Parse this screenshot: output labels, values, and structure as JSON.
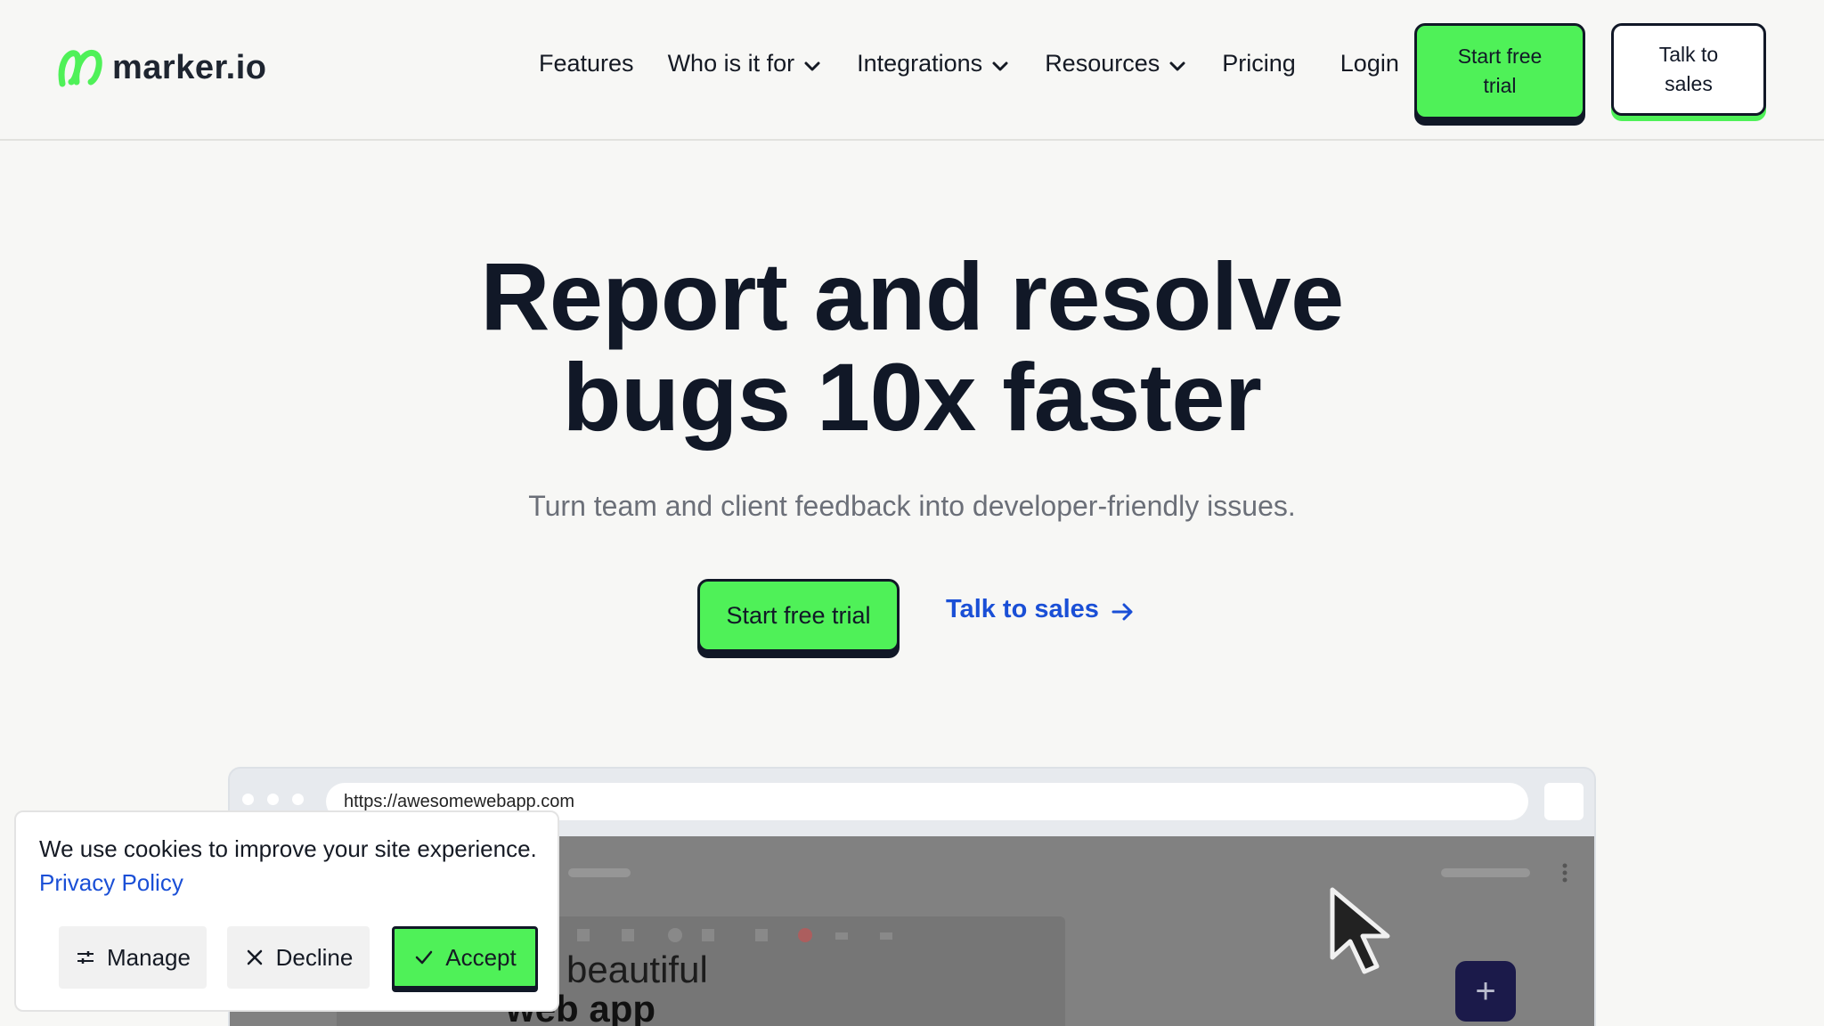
{
  "header": {
    "logo_text": "marker.io",
    "nav": [
      {
        "label": "Features",
        "has_dropdown": false
      },
      {
        "label": "Who is it for",
        "has_dropdown": true
      },
      {
        "label": "Integrations",
        "has_dropdown": true
      },
      {
        "label": "Resources",
        "has_dropdown": true
      },
      {
        "label": "Pricing",
        "has_dropdown": false
      },
      {
        "label": "Login",
        "has_dropdown": false
      }
    ],
    "trial_button": "Start free trial",
    "sales_button": "Talk to sales"
  },
  "hero": {
    "title_line1": "Report and resolve",
    "title_line2": "bugs 10x faster",
    "subtitle": "Turn team and client feedback into developer-friendly issues.",
    "cta_trial": "Start free trial",
    "cta_sales": "Talk to sales"
  },
  "browser_mock": {
    "url": "https://awesomewebapp.com",
    "headline_line1": "beautiful",
    "headline_line2": "web app",
    "fab_symbol": "+"
  },
  "cookie_banner": {
    "message": "We use cookies to improve your site experience.",
    "privacy_link": "Privacy Policy",
    "manage_label": "Manage",
    "decline_label": "Decline",
    "accept_label": "Accept"
  },
  "colors": {
    "brand_green": "#4ff158",
    "ink": "#111827",
    "link_blue": "#1a4fd6",
    "background": "#f7f7f5"
  }
}
